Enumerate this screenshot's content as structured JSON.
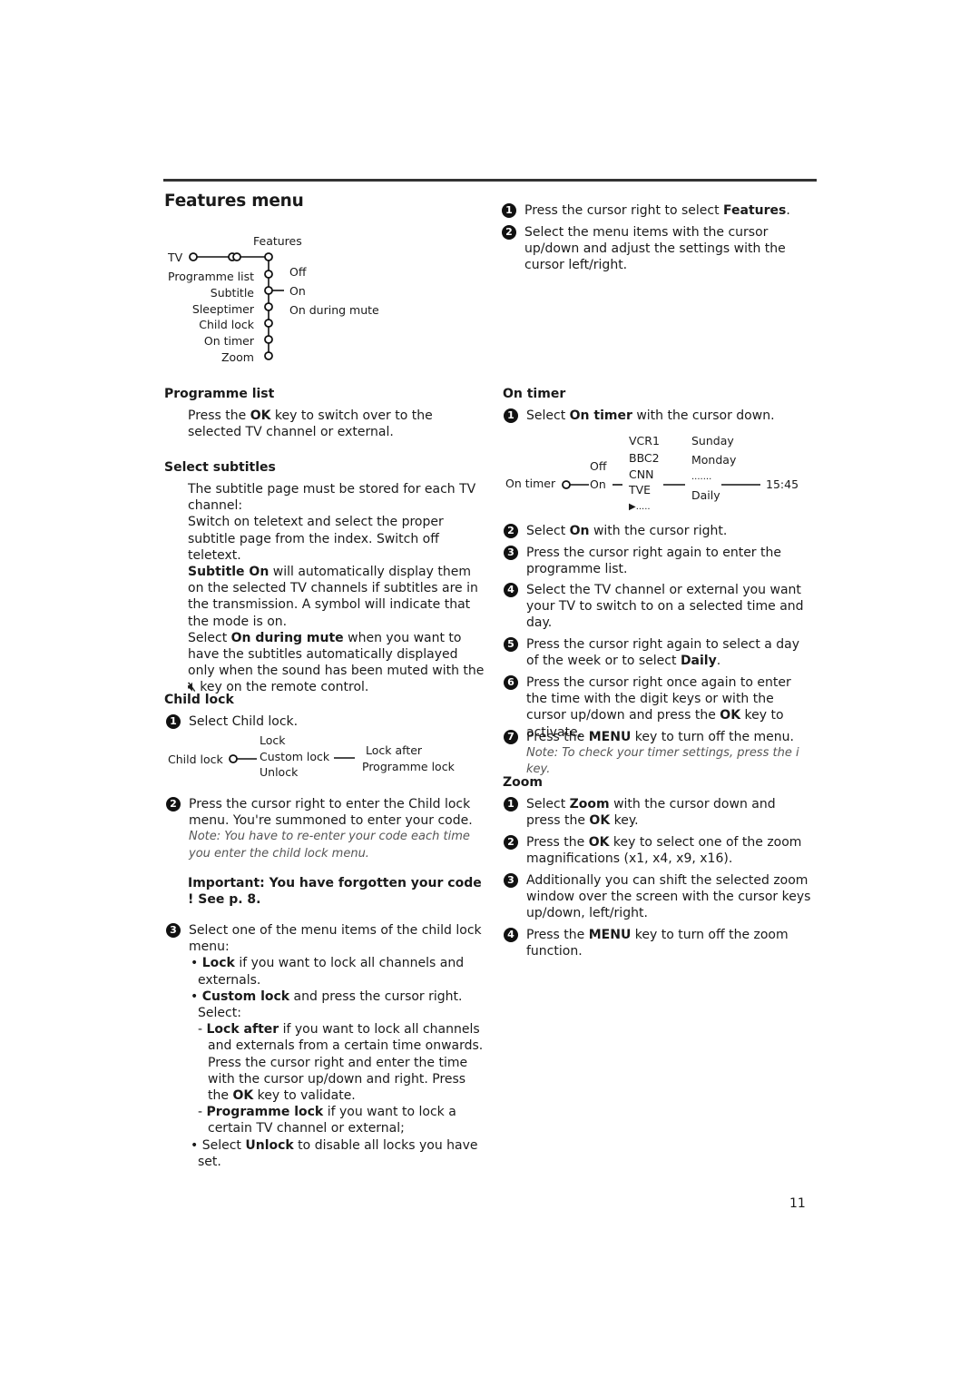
{
  "page": {
    "title": "Features menu",
    "page_number": "11"
  },
  "features_diagram": {
    "header": "Features",
    "root": "TV",
    "items": [
      "Programme list",
      "Subtitle",
      "Sleeptimer",
      "Child lock",
      "On timer",
      "Zoom"
    ],
    "subtitle_options": [
      "Off",
      "On",
      "On during mute"
    ]
  },
  "intro_steps": [
    {
      "num": "1",
      "pre": "Press the cursor right to select ",
      "bold": "Features",
      "post": "."
    },
    {
      "num": "2",
      "text": "Select the menu items with the cursor up/down and adjust the settings with the cursor left/right."
    }
  ],
  "programme_list": {
    "heading": "Programme list",
    "pre": "Press the ",
    "bold": "OK",
    "post": " key to switch over to the selected TV channel or external."
  },
  "select_subtitles": {
    "heading": "Select subtitles",
    "p1": "The subtitle page must be stored for each TV channel:",
    "p2": "Switch on teletext and select the proper subtitle page from the index. Switch off teletext.",
    "p3_bold": "Subtitle On",
    "p3_rest": " will automatically display them on the selected TV channels if subtitles are in the transmission. A symbol will indicate that the mode is on.",
    "p4_pre": "Select ",
    "p4_bold": "On during mute",
    "p4_rest": " when you want to have the subtitles automatically displayed only when the sound has been muted with the ",
    "p4_icon": "mute-icon",
    "p4_end": " key on the remote control."
  },
  "child_lock": {
    "heading": "Child lock",
    "step1": "Select Child lock.",
    "diagram": {
      "root": "Child lock",
      "options": [
        "Lock",
        "Custom lock",
        "Unlock"
      ],
      "custom_options": [
        "Lock after",
        "Programme lock"
      ]
    },
    "step2": "Press the cursor right to enter the Child lock menu. You're summoned to enter your code.",
    "step2_note": "Note: You have to re-enter your code each time you enter the child lock menu.",
    "important": "Important: You have forgotten your code ! See p. 8.",
    "step3": "Select one of the menu items of the child lock menu:",
    "bullets": [
      {
        "bold": "Lock",
        "rest": " if you want to lock all channels and externals."
      },
      {
        "bold": "Custom lock",
        "rest": " and press the cursor right. Select:"
      }
    ],
    "sub_bullets": [
      {
        "bold": "Lock after",
        "rest": " if you want to lock all channels and externals from a certain time onwards. Press the cursor right and enter the time with the cursor up/down and right. Press the ",
        "bold2": "OK",
        "rest2": " key to validate."
      },
      {
        "bold": "Programme lock",
        "rest": " if you want to lock a certain TV channel or external;"
      }
    ],
    "last_bullet": {
      "pre": "Select ",
      "bold": "Unlock",
      "rest": " to disable all locks you have set."
    }
  },
  "on_timer": {
    "heading": "On timer",
    "step1_pre": "Select ",
    "step1_bold": "On timer",
    "step1_post": " with the cursor down.",
    "diagram": {
      "root": "On timer",
      "states": [
        "Off",
        "On"
      ],
      "channels": [
        "VCR1",
        "BBC2",
        "CNN",
        "TVE",
        "▶....."
      ],
      "days": [
        "Sunday",
        "Monday",
        ".......",
        "Daily"
      ],
      "time": "15:45"
    },
    "steps": [
      {
        "num": "2",
        "pre": "Select ",
        "bold": "On",
        "post": " with the cursor right."
      },
      {
        "num": "3",
        "text": "Press the cursor right again to enter the programme list."
      },
      {
        "num": "4",
        "text": "Select the TV channel or external you want your TV to switch to on a selected time and day."
      },
      {
        "num": "5",
        "pre": "Press the cursor right again to select a day of the week or to select ",
        "bold": "Daily",
        "post": "."
      },
      {
        "num": "6",
        "pre": "Press the cursor right once again to enter the time with the digit keys or with the cursor up/down and press the ",
        "bold": "OK",
        "post": " key to activate."
      },
      {
        "num": "7",
        "pre": "Press the ",
        "bold": "MENU",
        "post": " key to turn off the menu."
      }
    ],
    "note": "Note: To check your timer settings, press the i key."
  },
  "zoom": {
    "heading": "Zoom",
    "steps": [
      {
        "num": "1",
        "pre": "Select ",
        "bold": "Zoom",
        "mid": " with the cursor down and press the ",
        "bold2": "OK",
        "post": " key."
      },
      {
        "num": "2",
        "pre": "Press the ",
        "bold": "OK",
        "post": " key to select one of the zoom magnifications (x1, x4, x9, x16)."
      },
      {
        "num": "3",
        "text": "Additionally you can shift the selected zoom window over the screen with the cursor keys up/down, left/right."
      },
      {
        "num": "4",
        "pre": "Press the ",
        "bold": "MENU",
        "post": " key to turn off the zoom function."
      }
    ]
  }
}
